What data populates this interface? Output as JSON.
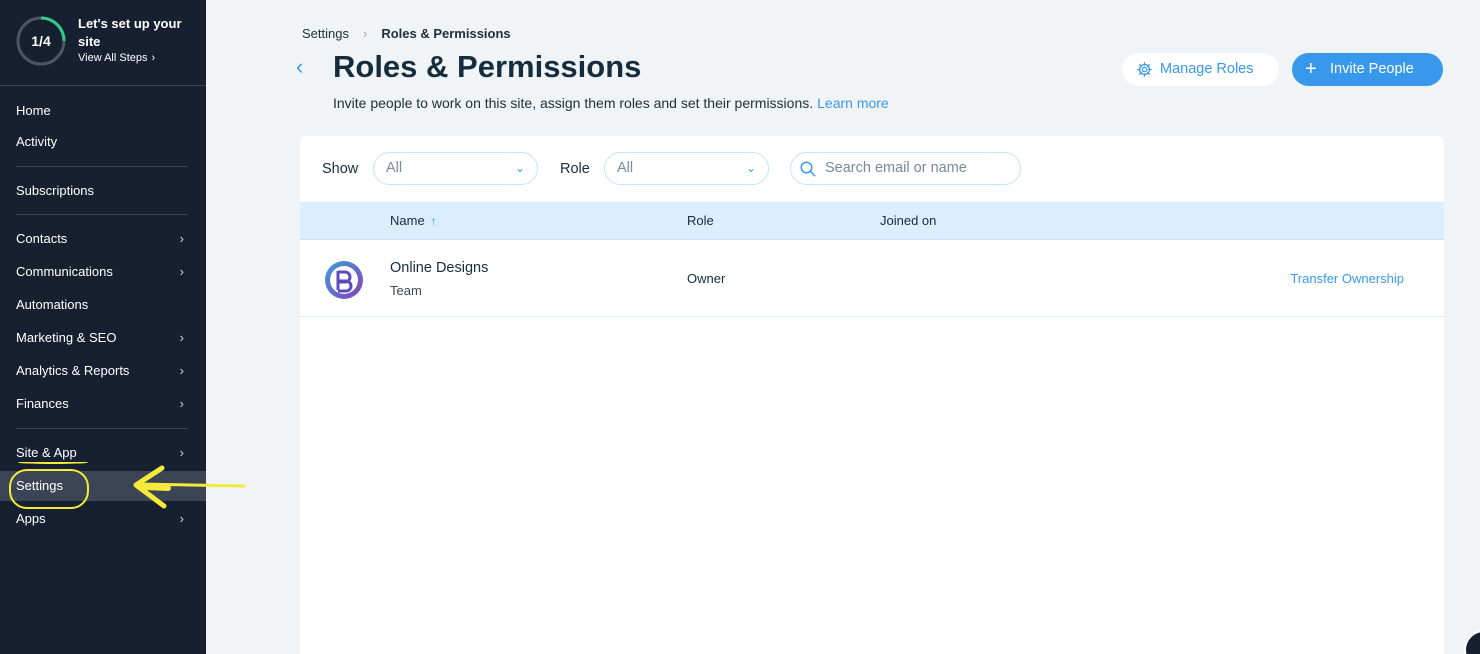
{
  "sidebar": {
    "setup": {
      "progress": "1/4",
      "progress_fraction": 0.25,
      "title": "Let's set up your site",
      "link": "View All Steps"
    },
    "items": [
      {
        "label": "Home"
      },
      {
        "label": "Activity"
      },
      {
        "label": "Subscriptions"
      },
      {
        "label": "Contacts"
      },
      {
        "label": "Communications"
      },
      {
        "label": "Automations"
      },
      {
        "label": "Marketing & SEO"
      },
      {
        "label": "Analytics & Reports"
      },
      {
        "label": "Finances"
      },
      {
        "label": "Site & App"
      },
      {
        "label": "Settings"
      },
      {
        "label": "Apps"
      }
    ]
  },
  "breadcrumb": {
    "parent": "Settings",
    "current": "Roles & Permissions"
  },
  "header": {
    "title": "Roles & Permissions",
    "subtitle": "Invite people to work on this site, assign them roles and set their permissions.",
    "learn_more": "Learn more",
    "manage_roles": "Manage Roles",
    "invite_people": "Invite People"
  },
  "filters": {
    "show_label": "Show",
    "show_value": "All",
    "role_label": "Role",
    "role_value": "All",
    "search_placeholder": "Search email or name"
  },
  "table": {
    "columns": [
      "Name",
      "Role",
      "Joined on"
    ],
    "rows": [
      {
        "name": "Online Designs",
        "sub": "Team",
        "role": "Owner",
        "joined": "",
        "action": "Transfer Ownership"
      }
    ]
  },
  "colors": {
    "accent": "#3899ec",
    "sidebar_bg": "#162030",
    "annotation": "#f5ea3a"
  }
}
